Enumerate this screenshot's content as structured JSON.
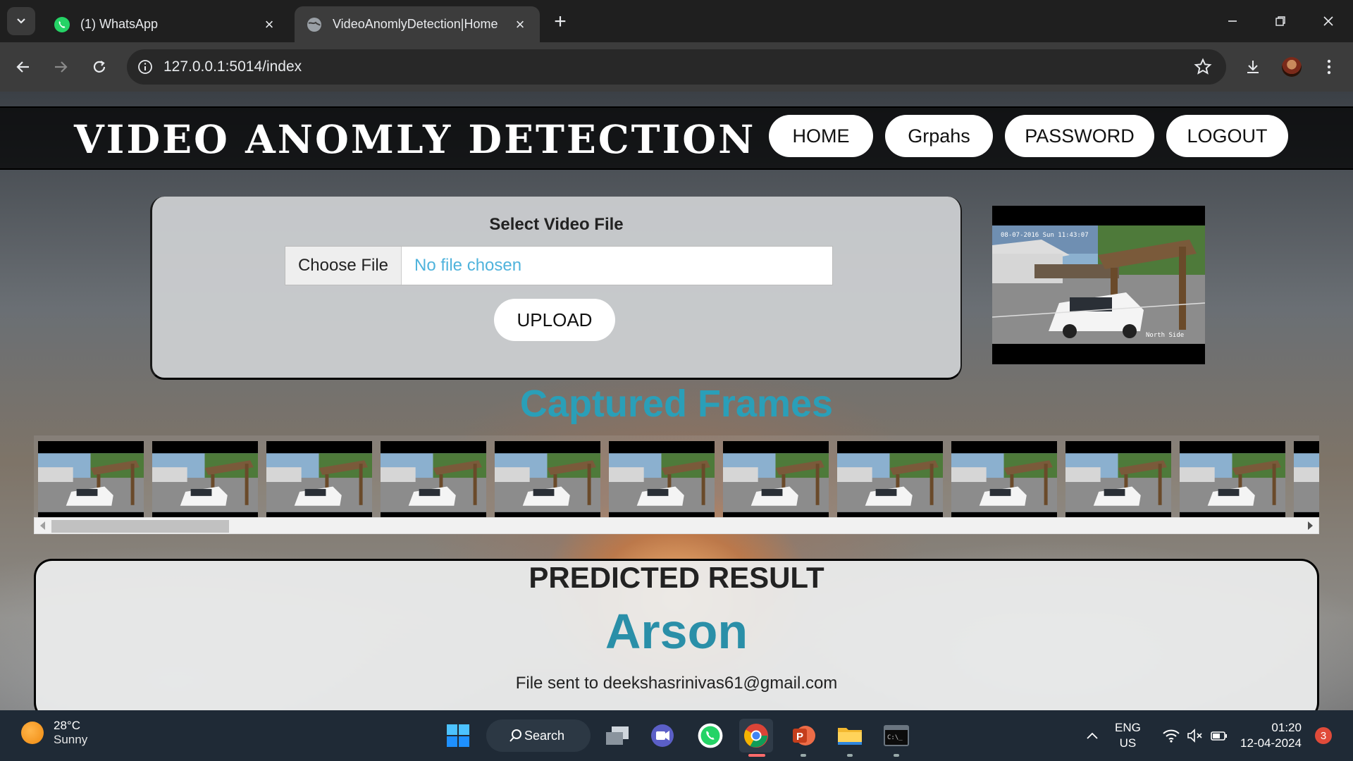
{
  "browser": {
    "tabs": [
      {
        "title": "(1) WhatsApp",
        "active": false
      },
      {
        "title": "VideoAnomlyDetection|Home",
        "active": true
      }
    ],
    "url": "127.0.0.1:5014/index"
  },
  "site": {
    "title": "VIDEO ANOMLY DETECTION",
    "nav": [
      "HOME",
      "Grpahs",
      "PASSWORD",
      "LOGOUT"
    ]
  },
  "upload": {
    "label": "Select Video File",
    "choose_button": "Choose File",
    "file_status": "No file chosen",
    "upload_button": "UPLOAD"
  },
  "video_preview": {
    "timestamp": "08-07-2016 Sun 11:43:07",
    "caption": "North Side"
  },
  "frames": {
    "title": "Captured Frames",
    "visible_count": 12
  },
  "result": {
    "heading": "PREDICTED RESULT",
    "value": "Arson",
    "note": "File sent to deekshasrinivas61@gmail.com"
  },
  "taskbar": {
    "weather_temp": "28°C",
    "weather_condition": "Sunny",
    "search_label": "Search",
    "lang_line1": "ENG",
    "lang_line2": "US",
    "time": "01:20",
    "date": "12-04-2024",
    "notification_count": "3"
  },
  "colors": {
    "accent_teal": "#2a9fb8",
    "file_status_blue": "#4fb3dc",
    "header_bg": "#000000"
  }
}
